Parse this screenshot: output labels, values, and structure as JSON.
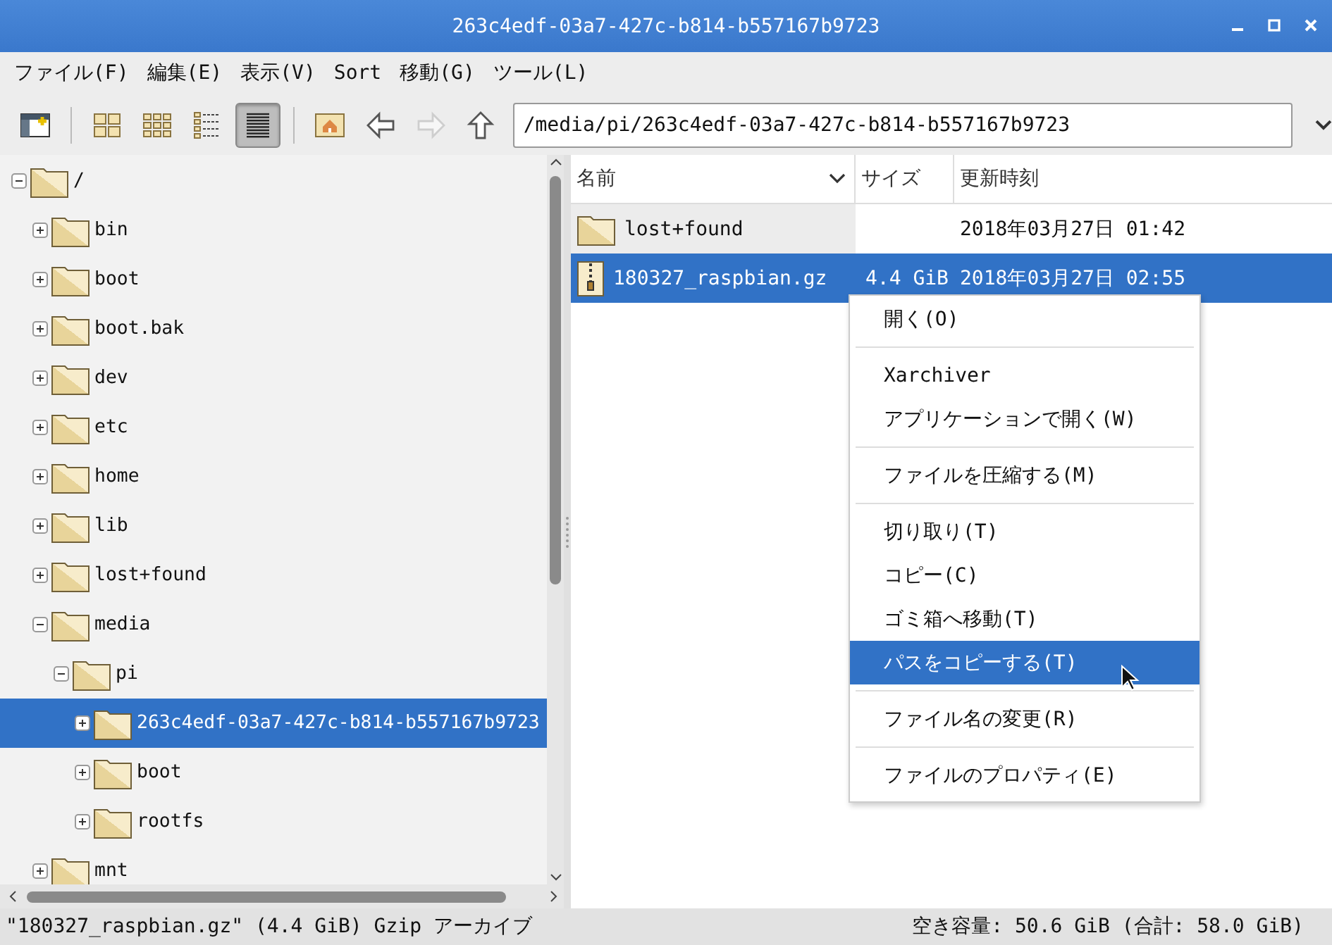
{
  "window": {
    "title": "263c4edf-03a7-427c-b814-b557167b9723"
  },
  "menu_bar": [
    "ファイル(F)",
    "編集(E)",
    "表示(V)",
    "Sort",
    "移動(G)",
    "ツール(L)"
  ],
  "toolbar": [
    {
      "kind": "new-window",
      "pressed": false,
      "disabled": false
    },
    {
      "kind": "sep"
    },
    {
      "kind": "icon-view",
      "pressed": false,
      "disabled": false
    },
    {
      "kind": "compact-view",
      "pressed": false,
      "disabled": false
    },
    {
      "kind": "list-view",
      "pressed": false,
      "disabled": false
    },
    {
      "kind": "detail-view",
      "pressed": true,
      "disabled": false
    },
    {
      "kind": "sep"
    },
    {
      "kind": "home",
      "pressed": false,
      "disabled": false
    },
    {
      "kind": "back",
      "pressed": false,
      "disabled": false
    },
    {
      "kind": "forward",
      "pressed": false,
      "disabled": true
    },
    {
      "kind": "up",
      "pressed": false,
      "disabled": false
    }
  ],
  "path_field": {
    "value": "/media/pi/263c4edf-03a7-427c-b814-b557167b9723"
  },
  "tree": [
    {
      "label": "/",
      "expanded": true,
      "selected": false,
      "children": [
        {
          "label": "bin",
          "expanded": false,
          "selected": false
        },
        {
          "label": "boot",
          "expanded": false,
          "selected": false
        },
        {
          "label": "boot.bak",
          "expanded": false,
          "selected": false
        },
        {
          "label": "dev",
          "expanded": false,
          "selected": false
        },
        {
          "label": "etc",
          "expanded": false,
          "selected": false
        },
        {
          "label": "home",
          "expanded": false,
          "selected": false
        },
        {
          "label": "lib",
          "expanded": false,
          "selected": false
        },
        {
          "label": "lost+found",
          "expanded": false,
          "selected": false
        },
        {
          "label": "media",
          "expanded": true,
          "selected": false,
          "children": [
            {
              "label": "pi",
              "expanded": true,
              "selected": false,
              "children": [
                {
                  "label": "263c4edf-03a7-427c-b814-b557167b9723",
                  "expanded": false,
                  "selected": true
                },
                {
                  "label": "boot",
                  "expanded": false,
                  "selected": false
                },
                {
                  "label": "rootfs",
                  "expanded": false,
                  "selected": false
                }
              ]
            }
          ]
        },
        {
          "label": "mnt",
          "expanded": false,
          "selected": false
        }
      ]
    }
  ],
  "file_list": {
    "columns": [
      {
        "label": "名前",
        "sorted": true
      },
      {
        "label": "サイズ",
        "sorted": false
      },
      {
        "label": "更新時刻",
        "sorted": false
      }
    ],
    "rows": [
      {
        "kind": "folder",
        "name": "lost+found",
        "size": "",
        "modified": "2018年03月27日 01:42",
        "selected": false
      },
      {
        "kind": "archive",
        "name": "180327_raspbian.gz",
        "size": "4.4 GiB",
        "modified": "2018年03月27日 02:55",
        "selected": true
      }
    ]
  },
  "context_menu": [
    {
      "kind": "item",
      "label": "開く(O)",
      "selected": false
    },
    {
      "kind": "separator"
    },
    {
      "kind": "item",
      "label": "Xarchiver",
      "selected": false
    },
    {
      "kind": "item",
      "label": "アプリケーションで開く(W)",
      "selected": false
    },
    {
      "kind": "separator"
    },
    {
      "kind": "item",
      "label": "ファイルを圧縮する(M)",
      "selected": false
    },
    {
      "kind": "separator"
    },
    {
      "kind": "item",
      "label": "切り取り(T)",
      "selected": false
    },
    {
      "kind": "item",
      "label": "コピー(C)",
      "selected": false
    },
    {
      "kind": "item",
      "label": "ゴミ箱へ移動(T)",
      "selected": false
    },
    {
      "kind": "item",
      "label": "パスをコピーする(T)",
      "selected": true
    },
    {
      "kind": "separator"
    },
    {
      "kind": "item",
      "label": "ファイル名の変更(R)",
      "selected": false
    },
    {
      "kind": "separator"
    },
    {
      "kind": "item",
      "label": "ファイルのプロパティ(E)",
      "selected": false
    }
  ],
  "status_bar": {
    "left": "\"180327_raspbian.gz\" (4.4 GiB) Gzip アーカイブ",
    "right": "空き容量: 50.6 GiB (合計: 58.0 GiB)"
  }
}
